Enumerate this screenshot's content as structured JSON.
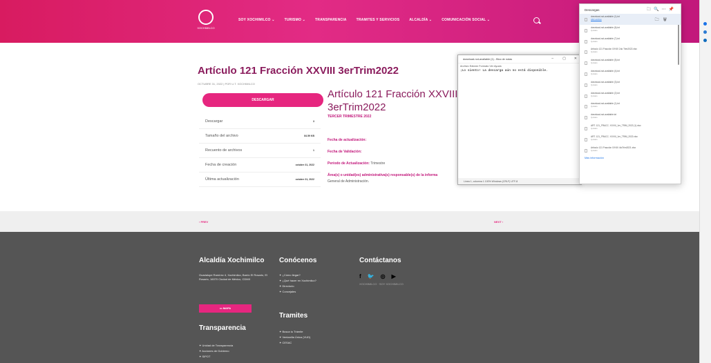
{
  "header": {
    "logo_text": "XOCHIMILCO",
    "nav": [
      "SOY XOCHIMILCO ⌄",
      "TURISMO ⌄",
      "TRANSPARENCIA",
      "TRAMITES Y SERVICIOS",
      "ALCALDÍA ⌄",
      "COMUNICACIÓN SOCIAL ⌄"
    ],
    "search_icon": "search-icon"
  },
  "page": {
    "title": "Artículo 121 Fracción XXVIII 3erTrim2022",
    "meta": "OCTUBRE 31, 2022  |  POR U.T. XOCHIMILCO",
    "download_button": "DESCARGAR",
    "info_rows": [
      {
        "label": "Descargar",
        "value": "3"
      },
      {
        "label": "Tamaño del archivo",
        "value": "84.59 KB"
      },
      {
        "label": "Recuento de archivos",
        "value": "1"
      },
      {
        "label": "Fecha de creación",
        "value": "octubre 31, 2022"
      },
      {
        "label": "Última actualización",
        "value": "octubre 31, 2022"
      }
    ],
    "article_title": "Artículo 121 Fracción XXVIII 3erTrim2022",
    "subtitle": "TERCER TRIMESTRE 2022",
    "fields": {
      "update": "Fecha de actualización:",
      "validation": "Fecha de Validación:",
      "period_label": "Período de Actualización:",
      "period_value": "Trimestre",
      "area_label": "Área(s) o unidad(es) administrativa(s) responsable(s) de la informa",
      "area_value": "General de Administración."
    }
  },
  "pager": {
    "prev": "‹ PREV",
    "next": "NEXT ›"
  },
  "footer": {
    "col1_title": "Alcaldía Xochimilco",
    "address": "Guadalupe Ramírez 4, Xochimilco, Barrio El Rosario, El Rosario, 16070 Ciudad de México, CDMX",
    "map_button": "MAPA",
    "transparency_title": "Transparencia",
    "transparency_items": [
      "Unidad de Transparencia",
      "Acciones de Gobierno",
      "SIPOT"
    ],
    "col2_title": "Conócenos",
    "col2_items": [
      "¿Cómo llegar?",
      "¿Qué hacer en Xochimilco?",
      "Directorio",
      "Concejales"
    ],
    "tramites_title": "Tramites",
    "tramites_items": [
      "Busca tu Trámite",
      "Ventanilla Única (VUD)",
      "CESAC"
    ],
    "col3_title": "Contáctanos",
    "social": [
      "f",
      "🐦",
      "◎",
      "▶"
    ],
    "social_link": "XOCHIMILCO · SOY XOCHIMILCO"
  },
  "notepad": {
    "title": "download-not-available (1) - Bloc de notas",
    "menu": "Archivo  Edición  Formato  Ver  Ayuda",
    "body": "¡Lo siento! La descarga aún no está disponible.",
    "status": "Línea 1, columna 1          100%   Windows (CRLF)     UTF-8"
  },
  "downloads": {
    "title": "Descargas",
    "items": [
      {
        "name": "download-not-available (1).txt",
        "status": "Abrir archivo"
      },
      {
        "name": "download-not-available (6).txt",
        "status": "Quitado"
      },
      {
        "name": "download-not-available (7).txt",
        "status": "Quitado"
      },
      {
        "name": "Artículo 121 Fracción XXVIII 2do Trim2022.xlsx",
        "status": "Quitado"
      },
      {
        "name": "download-not-available (5).txt",
        "status": "Quitado"
      },
      {
        "name": "download-not-available (4).txt",
        "status": "Quitado"
      },
      {
        "name": "download-not-available (3).txt",
        "status": "Quitado"
      },
      {
        "name": "download-not-available (2).txt",
        "status": "Quitado"
      },
      {
        "name": "download-not-available (1).txt",
        "status": "Quitado"
      },
      {
        "name": "download-not-available.txt",
        "status": "Quitado"
      },
      {
        "name": "ART. 121_FRACC. XXVIII_1er_TRIM_2022 (1).xlsx",
        "status": "Quitado"
      },
      {
        "name": "ART. 121_FRACC. XXVIII_1er_TRIM_2022.xlsx",
        "status": "Quitado"
      },
      {
        "name": "Artículo 121 Fracción XXVIII 4toTrim2021.xlsx",
        "status": "Quitado"
      }
    ],
    "more": "Más información"
  }
}
